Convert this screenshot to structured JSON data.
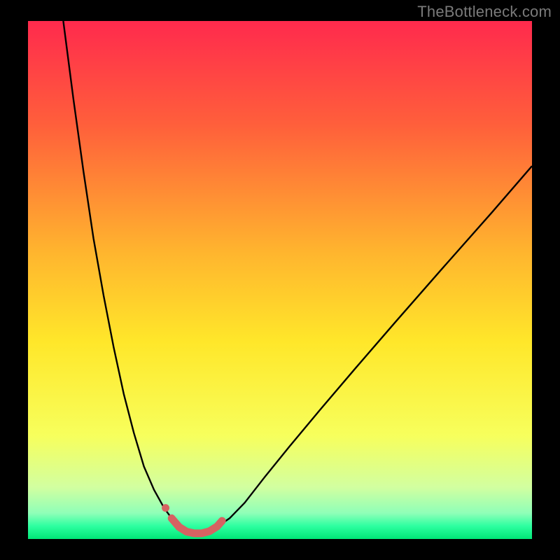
{
  "watermark": "TheBottleneck.com",
  "chart_data": {
    "type": "line",
    "title": "",
    "xlabel": "",
    "ylabel": "",
    "xlim": [
      0,
      100
    ],
    "ylim": [
      0,
      100
    ],
    "grid": false,
    "gradient_stops": [
      {
        "offset": 0.0,
        "color": "#ff2a4d"
      },
      {
        "offset": 0.2,
        "color": "#ff5f3b"
      },
      {
        "offset": 0.45,
        "color": "#ffb62e"
      },
      {
        "offset": 0.62,
        "color": "#ffe72a"
      },
      {
        "offset": 0.8,
        "color": "#f7ff5c"
      },
      {
        "offset": 0.9,
        "color": "#d2ffa0"
      },
      {
        "offset": 0.95,
        "color": "#8fffb8"
      },
      {
        "offset": 0.975,
        "color": "#2dffa0"
      },
      {
        "offset": 1.0,
        "color": "#00e676"
      }
    ],
    "series": [
      {
        "name": "left-branch",
        "stroke": "#000000",
        "width": 2.4,
        "x": [
          7,
          9,
          11,
          13,
          15,
          17,
          19,
          21,
          23,
          25,
          27,
          28.5,
          29.5
        ],
        "y": [
          100,
          85,
          71,
          58,
          47,
          37,
          28,
          20.5,
          14,
          9.5,
          6,
          4,
          3
        ]
      },
      {
        "name": "right-branch",
        "stroke": "#000000",
        "width": 2.4,
        "x": [
          38.5,
          40,
          43,
          47,
          52,
          58,
          65,
          73,
          82,
          92,
          100
        ],
        "y": [
          3,
          4,
          7,
          12,
          18,
          25,
          33,
          42,
          52,
          63,
          72
        ]
      },
      {
        "name": "highlight",
        "stroke": "#d66262",
        "width": 11,
        "linecap": "round",
        "x": [
          28.5,
          30,
          31.5,
          33,
          34.5,
          36,
          37.5,
          38.5
        ],
        "y": [
          4.0,
          2.3,
          1.4,
          1.1,
          1.1,
          1.5,
          2.4,
          3.5
        ]
      },
      {
        "name": "highlight-dot",
        "type": "scatter",
        "marker": "circle",
        "color": "#d66262",
        "size": 11,
        "x": [
          27.3
        ],
        "y": [
          6.0
        ]
      }
    ],
    "annotations": []
  }
}
